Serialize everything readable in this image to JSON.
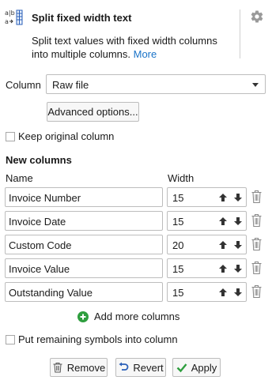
{
  "header": {
    "title": "Split fixed width text",
    "description": "Split text values with fixed width columns into multiple columns.",
    "more_link": "More",
    "icon": "split-text-icon",
    "settings_icon": "gear-icon"
  },
  "column_field": {
    "label": "Column",
    "selected": "Raw file"
  },
  "advanced_button": "Advanced options...",
  "keep_original": {
    "label": "Keep original column",
    "checked": false
  },
  "new_columns": {
    "title": "New columns",
    "name_header": "Name",
    "width_header": "Width",
    "rows": [
      {
        "name": "Invoice Number",
        "width": "15"
      },
      {
        "name": "Invoice Date",
        "width": "15"
      },
      {
        "name": "Custom Code",
        "width": "20"
      },
      {
        "name": "Invoice Value",
        "width": "15"
      },
      {
        "name": "Outstanding Value",
        "width": "15"
      }
    ]
  },
  "add_more": "Add more columns",
  "put_remaining": {
    "label": "Put remaining symbols into column",
    "checked": false
  },
  "footer": {
    "remove_label": "Remove",
    "revert_label": "Revert",
    "apply_label": "Apply"
  },
  "colors": {
    "link": "#1a73c8",
    "add_green": "#2e9e3e",
    "apply_check": "#2e9e3e",
    "revert_arrow": "#2a5fb8"
  }
}
